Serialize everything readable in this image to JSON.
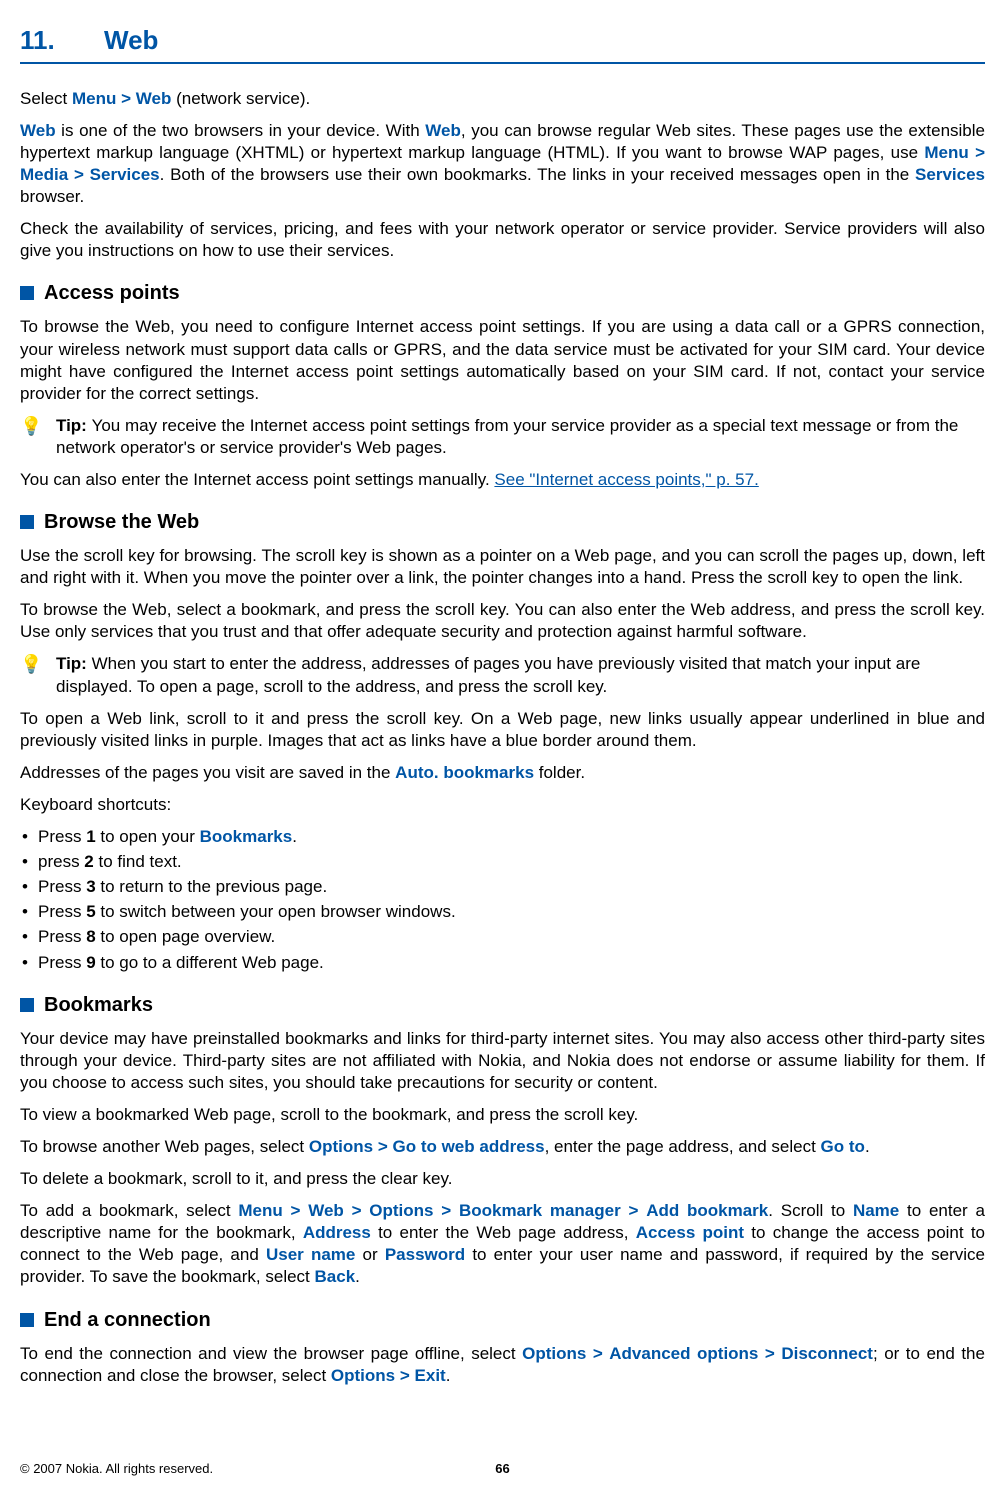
{
  "chapter": {
    "num": "11.",
    "title": "Web"
  },
  "intro": {
    "p1_a": "Select ",
    "menu": "Menu",
    "web": "Web",
    "p1_b": " (network service).",
    "p2_a": " is one of the two browsers in your device. With ",
    "p2_b": ", you can browse regular Web sites. These pages use the extensible hypertext markup language (XHTML) or hypertext markup language (HTML). If you want to browse WAP pages, use ",
    "media": "Media",
    "services": "Services",
    "p2_c": ". Both of the browsers use their own bookmarks. The links in your received messages open in the ",
    "p2_d": " browser.",
    "p3": "Check the availability of services, pricing, and fees with your network operator or service provider. Service providers will also give you instructions on how to use their services."
  },
  "access": {
    "title": "Access points",
    "p1": "To browse the Web, you need to configure Internet access point settings. If you are using a data call or a GPRS connection, your wireless network must support data calls or GPRS, and the data service must be activated for your SIM card. Your device might have configured the Internet access point settings automatically based on your SIM card. If not, contact your service provider for the correct settings.",
    "tip_label": "Tip: ",
    "tip": "You may receive the Internet access point settings from your service provider as a special text message or from the network operator's or service provider's Web pages.",
    "p2_a": "You can also enter the Internet access point settings manually. ",
    "link": "See \"Internet access points,\" p. 57."
  },
  "browse": {
    "title": "Browse the Web",
    "p1": "Use the scroll key for browsing. The scroll key is shown as a pointer on a Web page, and you can scroll the pages up, down, left and right with it. When you move the pointer over a link, the pointer changes into a hand. Press the scroll key to open the link.",
    "p2": "To browse the Web, select a bookmark, and press the scroll key. You can also enter the Web address, and press the scroll key. Use only services that you trust and that offer adequate security and protection against harmful software.",
    "tip_label": "Tip: ",
    "tip": "When you start to enter the address, addresses of pages you have previously visited that match your input are displayed. To open a page, scroll to the address, and press the scroll key.",
    "p3": "To open a Web link, scroll to it and press the scroll key. On a Web page, new links usually appear underlined in blue and previously visited links in purple. Images that act as links have a blue border around them.",
    "p4_a": "Addresses of the pages you visit are saved in the ",
    "auto": "Auto. bookmarks",
    "p4_b": " folder.",
    "ks_label": "Keyboard shortcuts:",
    "li1_a": "Press ",
    "k1": "1",
    "li1_b": " to open your ",
    "bookmarks": "Bookmarks",
    "li1_c": ".",
    "li2_a": "press ",
    "k2": "2",
    "li2_b": " to find text.",
    "li3_a": "Press ",
    "k3": "3",
    "li3_b": " to return to the previous page.",
    "li4_a": "Press ",
    "k5": "5",
    "li4_b": " to switch between your open browser windows.",
    "li5_a": "Press ",
    "k8": "8",
    "li5_b": " to open page overview.",
    "li6_a": "Press ",
    "k9": "9",
    "li6_b": " to go to a different Web page."
  },
  "bm": {
    "title": "Bookmarks",
    "p1": "Your device may have preinstalled bookmarks and links for third-party internet sites. You may also access other third-party sites through your device. Third-party sites are not affiliated with Nokia, and Nokia does not endorse or assume liability for them. If you choose to access such sites, you should take precautions for security or content.",
    "p2": "To view a bookmarked Web page, scroll to the bookmark, and press the scroll key.",
    "p3_a": "To browse another Web pages, select ",
    "options": "Options",
    "gotoaddr": "Go to web address",
    "p3_b": ", enter the page address, and select ",
    "goto": "Go to",
    "p3_c": ".",
    "p4": "To delete a bookmark, scroll to it, and press the clear key.",
    "p5_a": "To add a bookmark, select ",
    "menu": "Menu",
    "web": "Web",
    "bmmgr": "Bookmark manager",
    "addbm": "Add bookmark",
    "p5_b": ". Scroll to ",
    "name": "Name",
    "p5_c": " to enter a descriptive name for the bookmark, ",
    "address": "Address",
    "p5_d": " to enter the Web page address, ",
    "ap": "Access point",
    "p5_e": " to change the access point to connect to the Web page, and ",
    "user": "User name",
    "or": " or ",
    "pass": "Password",
    "p5_f": " to enter your user name and password, if required by the service provider. To save the bookmark, select ",
    "back": "Back",
    "p5_g": "."
  },
  "end": {
    "title": "End a connection",
    "p1_a": "To end the connection and view the browser page offline, select ",
    "options": "Options",
    "adv": "Advanced options",
    "disc": "Disconnect",
    "p1_b": "; or to end the connection and close the browser, select ",
    "exit": "Exit",
    "p1_c": "."
  },
  "footer": {
    "copy": "© 2007 Nokia. All rights reserved.",
    "page": "66"
  },
  "gt": ">"
}
